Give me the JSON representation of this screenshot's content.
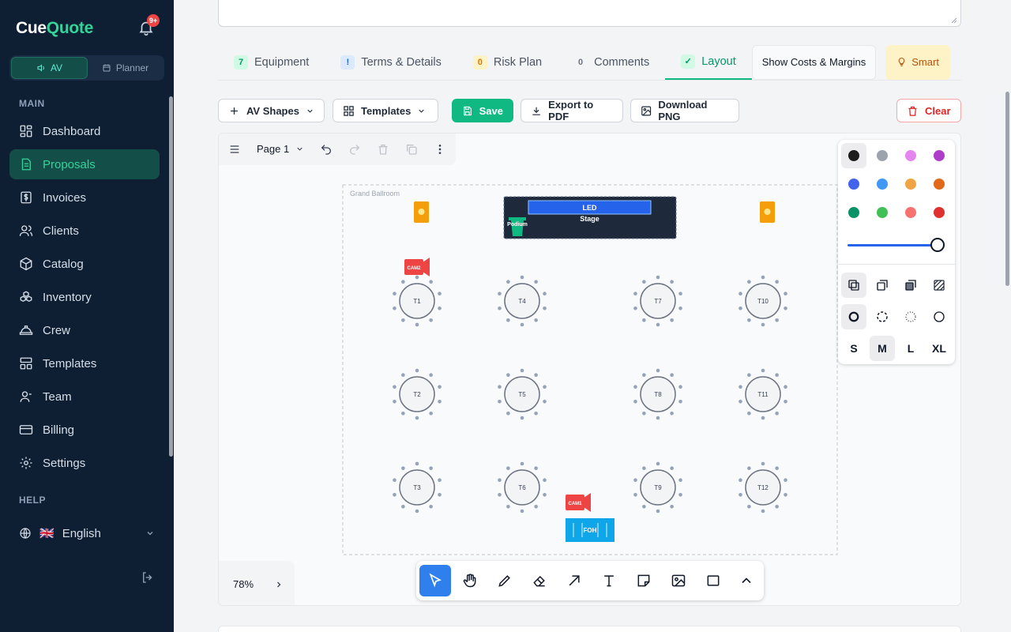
{
  "app": {
    "logo_main": "Cue",
    "logo_accent": "Quote",
    "notification_badge": "9+",
    "modes": [
      {
        "label": "AV",
        "active": true
      },
      {
        "label": "Planner",
        "active": false
      }
    ]
  },
  "sidebar": {
    "section_main": "MAIN",
    "items": [
      {
        "label": "Dashboard",
        "icon": "dashboard-icon"
      },
      {
        "label": "Proposals",
        "icon": "document-icon",
        "active": true
      },
      {
        "label": "Invoices",
        "icon": "dollar-icon"
      },
      {
        "label": "Clients",
        "icon": "users-icon"
      },
      {
        "label": "Catalog",
        "icon": "box-icon"
      },
      {
        "label": "Inventory",
        "icon": "boxes-icon"
      },
      {
        "label": "Crew",
        "icon": "hardhat-icon"
      },
      {
        "label": "Templates",
        "icon": "templates-icon"
      },
      {
        "label": "Team",
        "icon": "team-icon"
      },
      {
        "label": "Billing",
        "icon": "card-icon"
      },
      {
        "label": "Settings",
        "icon": "gear-icon"
      }
    ],
    "section_help": "HELP",
    "language": {
      "flag": "🇬🇧",
      "label": "English"
    }
  },
  "tabs": [
    {
      "count": "7",
      "label": "Equipment",
      "badge": "green"
    },
    {
      "count": "!",
      "label": "Terms & Details",
      "badge": "blue"
    },
    {
      "count": "0",
      "label": "Risk Plan",
      "badge": "amber"
    },
    {
      "count": "0",
      "label": "Comments",
      "badge": "gray"
    },
    {
      "count": "✓",
      "label": "Layout",
      "badge": "green",
      "active": true
    }
  ],
  "tab_actions": {
    "costs": "Show Costs & Margins",
    "smart": "Smart"
  },
  "toolbar": {
    "shapes": "AV Shapes",
    "templates": "Templates",
    "save": "Save",
    "export": "Export to PDF",
    "download": "Download PNG",
    "clear": "Clear"
  },
  "canvas": {
    "page": "Page 1",
    "zoom": "78%",
    "room_label": "Grand Ballroom",
    "stage": {
      "screen": "LED",
      "label": "Stage",
      "podium": "Podium"
    },
    "tables": [
      "T1",
      "T2",
      "T3",
      "T4",
      "T5",
      "T6",
      "T7",
      "T8",
      "T9",
      "T10",
      "T11",
      "T12"
    ],
    "cameras": [
      "CAM2",
      "CAM1"
    ],
    "foh": "FOH"
  },
  "style_panel": {
    "colors": [
      "#1d1d1d",
      "#9ca3af",
      "#e585f0",
      "#ae3ec9",
      "#4263eb",
      "#4098f5",
      "#f0a443",
      "#e16919",
      "#099268",
      "#40c057",
      "#f87171",
      "#e03131"
    ],
    "sizes": [
      "S",
      "M",
      "L",
      "XL"
    ],
    "selected_size": "M",
    "opacity": 1.0
  }
}
